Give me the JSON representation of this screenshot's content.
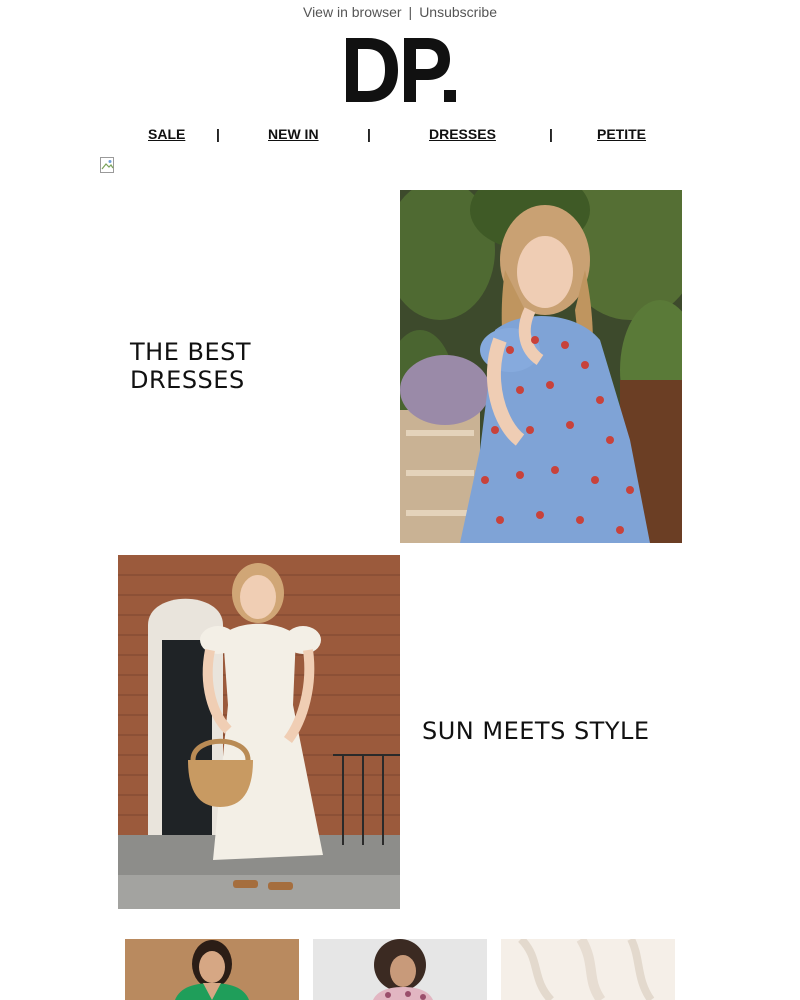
{
  "preheader": {
    "view_in_browser": "View in browser",
    "separator": "|",
    "unsubscribe": "Unsubscribe"
  },
  "brand": {
    "logo_text": "DP."
  },
  "nav": {
    "items": [
      {
        "label": "SALE"
      },
      {
        "label": "NEW IN"
      },
      {
        "label": "DRESSES"
      },
      {
        "label": "PETITE"
      }
    ],
    "separator": "|"
  },
  "hero1": {
    "headline": "THE BEST\nDRESSES",
    "line1": "THE BEST",
    "line2": "DRESSES",
    "image": "woman-floral-blue-dress-photo"
  },
  "hero2": {
    "headline": "SUN MEETS STYLE",
    "image": "woman-white-dress-straw-bag-photo"
  },
  "products": [
    {
      "image": "green-blazer-model-photo"
    },
    {
      "image": "floral-top-model-photo"
    },
    {
      "image": "white-textured-fabric-photo"
    }
  ],
  "colors": {
    "text": "#111111",
    "muted": "#555555",
    "background": "#ffffff"
  }
}
